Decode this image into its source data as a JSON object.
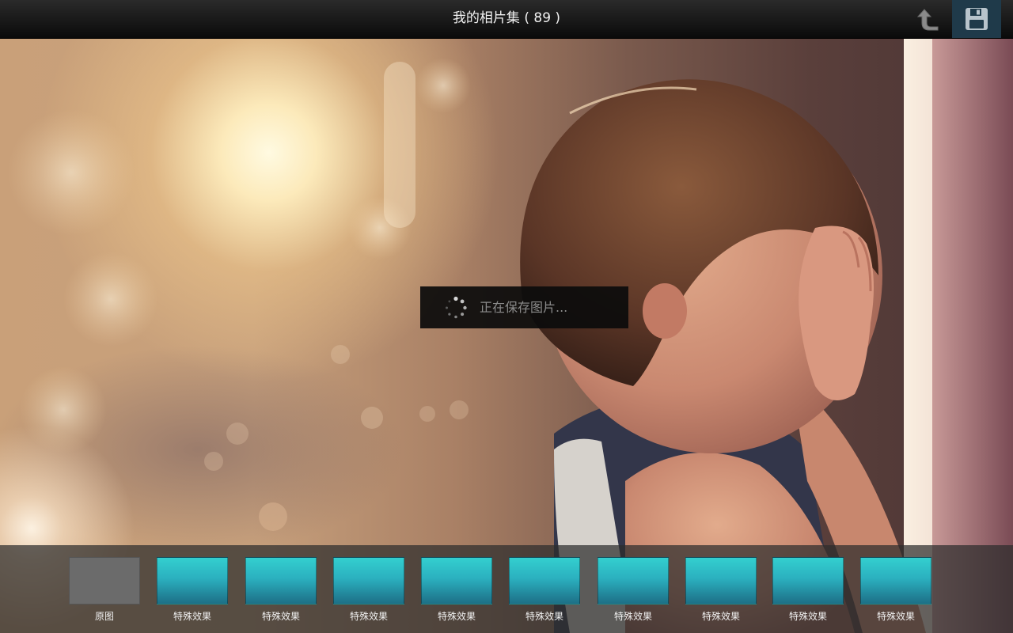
{
  "header": {
    "title": "我的相片集 ( 89 )",
    "back_icon": "back-arrow-icon",
    "save_icon": "floppy-disk-icon",
    "accent_save_bg": "#1f3a4a"
  },
  "toast": {
    "message": "正在保存图片...",
    "icon": "loading-spinner-icon"
  },
  "photo": {
    "description_icon": "photo-preview"
  },
  "filters": {
    "items": [
      {
        "label": "原图",
        "selected": false,
        "color": "#6b6b6b"
      },
      {
        "label": "特殊效果",
        "color": "#2bb0bf"
      },
      {
        "label": "特殊效果",
        "color": "#2bb0bf"
      },
      {
        "label": "特殊效果",
        "color": "#2bb0bf"
      },
      {
        "label": "特殊效果",
        "color": "#2bb0bf"
      },
      {
        "label": "特殊效果",
        "color": "#2bb0bf"
      },
      {
        "label": "特殊效果",
        "color": "#2bb0bf"
      },
      {
        "label": "特殊效果",
        "color": "#2bb0bf"
      },
      {
        "label": "特殊效果",
        "color": "#2bb0bf"
      },
      {
        "label": "特殊效果",
        "color": "#2bb0bf"
      }
    ]
  }
}
